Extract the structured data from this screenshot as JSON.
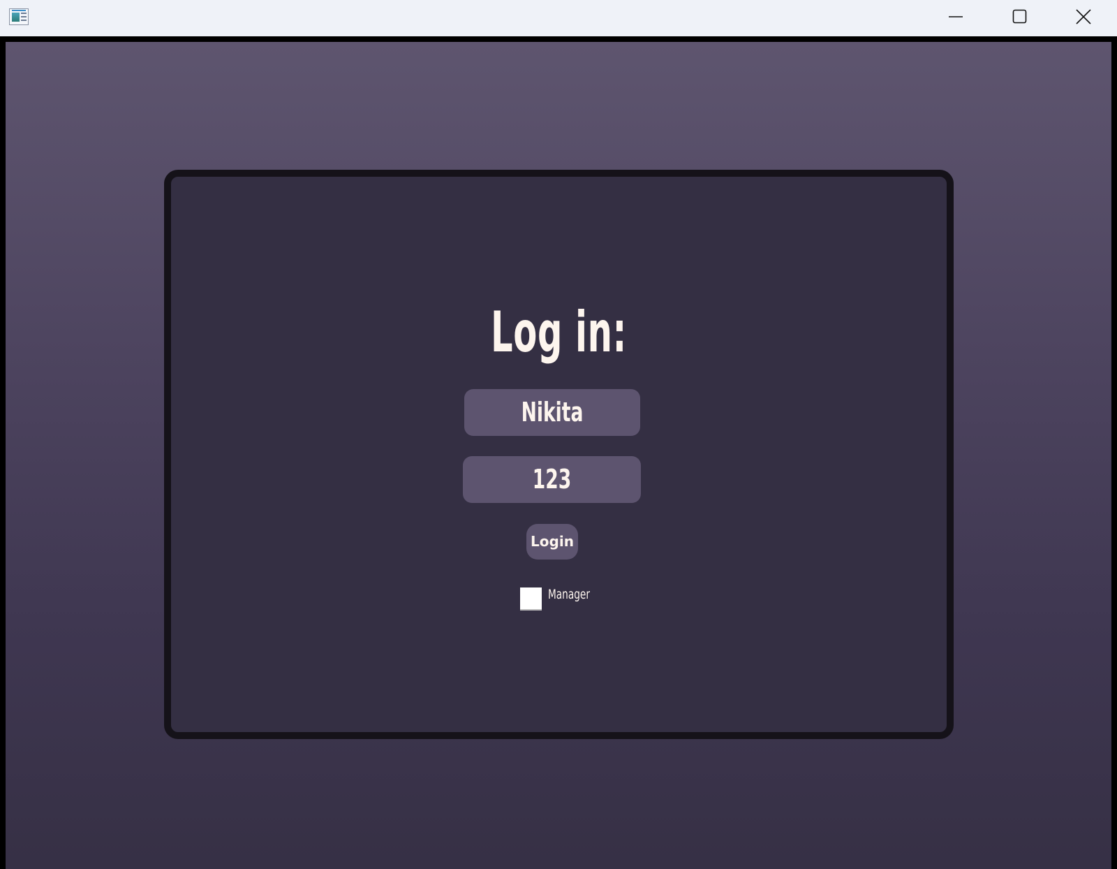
{
  "window": {
    "controls": {
      "minimize_icon": "minimize-icon",
      "maximize_icon": "maximize-icon",
      "close_icon": "close-icon"
    }
  },
  "login": {
    "title": "Log in:",
    "username_value": "Nikita",
    "password_value": "123",
    "button_label": "Login",
    "checkbox_label": "Manager",
    "checkbox_checked": false
  },
  "colors": {
    "card_background": "#342f43",
    "card_border": "#151219",
    "field_background": "#5d546f",
    "text": "#fdf5ee"
  }
}
